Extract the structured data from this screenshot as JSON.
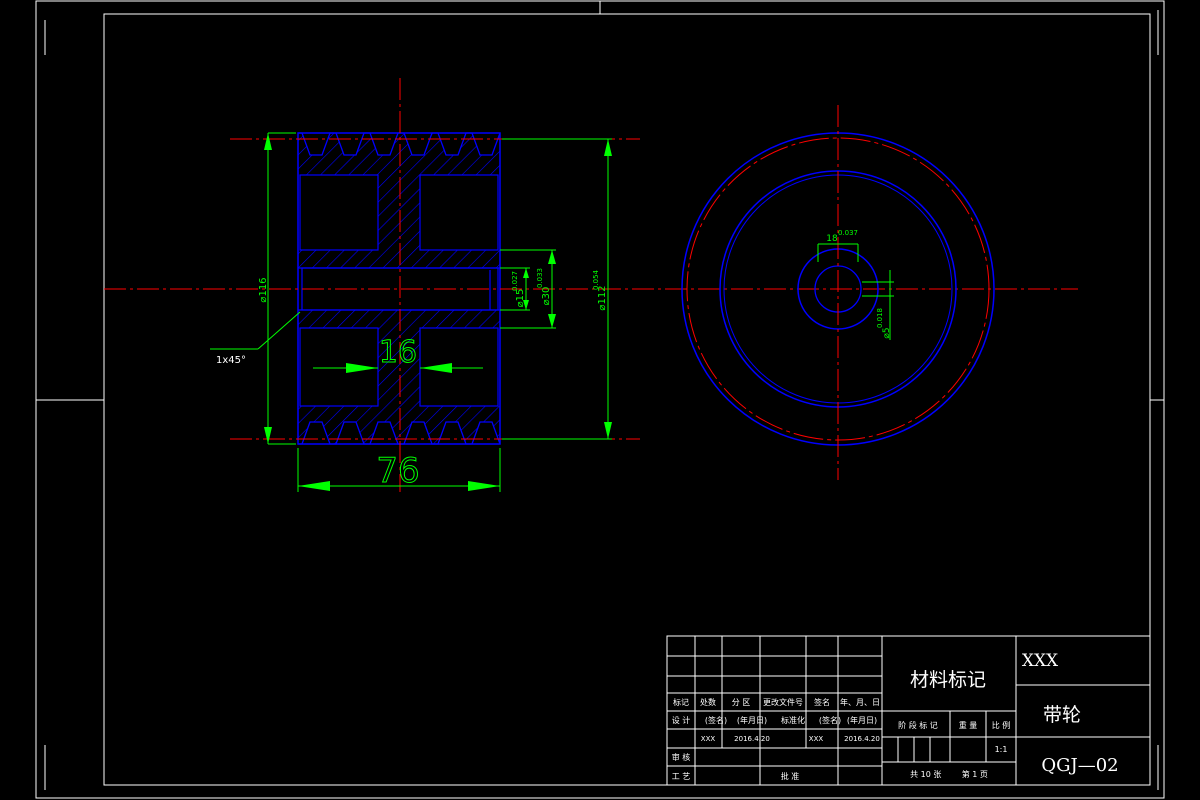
{
  "drawing": {
    "colors": {
      "background": "#000000",
      "frame": "#ffffff",
      "part": "#0000ff",
      "dimension": "#00ff00",
      "centerline": "#ff0000"
    },
    "section_view": {
      "dim_width": "76",
      "dim_slot": "16",
      "dim_outer_dia": "⌀116",
      "dim_pitch_dia": "⌀112",
      "dim_pitch_tol": "0.054",
      "dim_bore": "⌀30",
      "dim_bore_tol": "0.033",
      "dim_inner": "⌀15",
      "dim_inner_tol": "0.027",
      "chamfer": "1x45°"
    },
    "end_view": {
      "keyway": "18",
      "keyway_tol": "0.037",
      "hub_dia": "⌀5",
      "hub_tol": "0.018"
    }
  },
  "title_block": {
    "material_mark": "材料标记",
    "company": "XXX",
    "part_name": "带轮",
    "drawing_number": "QGJ—02",
    "rev_headers": [
      "标记",
      "处数",
      "分 区",
      "更改文件号",
      "签名",
      "年、月、日"
    ],
    "sign_row": [
      "设 计",
      "(签名)",
      "(年月日)",
      "标准化",
      "(签名)",
      "(年月日)"
    ],
    "sign_values": [
      "XXX",
      "2016.4.20",
      "XXX",
      "2016.4.20"
    ],
    "review": "审 核",
    "process": "工 艺",
    "approve": "批 准",
    "stage_headers": [
      "阶 段 标 记",
      "重 量",
      "比 例"
    ],
    "scale": "1:1",
    "sheet_info": "共 10 张        第 1 页"
  }
}
